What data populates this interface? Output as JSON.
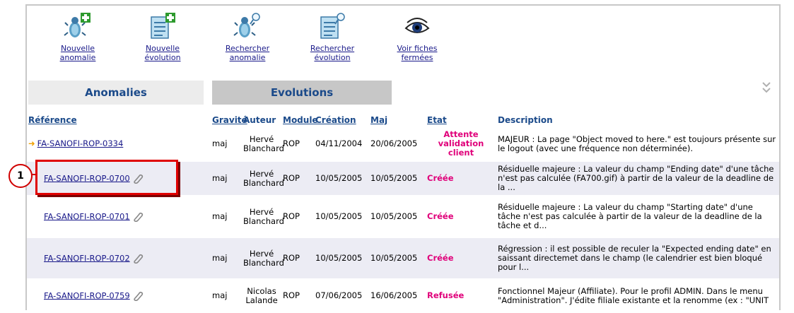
{
  "toolbar": {
    "new_anomaly": [
      "Nouvelle",
      "anomalie"
    ],
    "new_evolution": [
      "Nouvelle",
      "évolution"
    ],
    "search_anomaly": [
      "Rechercher",
      "anomalie"
    ],
    "search_evolution": [
      "Rechercher",
      "évolution"
    ],
    "closed_files": [
      "Voir fiches",
      "fermées"
    ]
  },
  "tabs": {
    "anomalies": "Anomalies",
    "evolutions": "Evolutions"
  },
  "columns": {
    "reference": "Référence",
    "gravite": "Gravité",
    "auteur": "Auteur",
    "module": "Module",
    "creation": "Création",
    "maj": "Maj",
    "etat": "Etat",
    "description": "Description"
  },
  "rows": [
    {
      "reference": "FA-SANOFI-ROP-0334",
      "gravite": "maj",
      "auteur": [
        "Hervé",
        "Blanchard"
      ],
      "module": "ROP",
      "creation": "04/11/2004",
      "maj": "20/06/2005",
      "etat": [
        "Attente",
        "validation",
        "client"
      ],
      "description": "MAJEUR : La page \"Object moved to here.\" est toujours présente sur le logout (avec une fréquence non déterminée)."
    },
    {
      "reference": "FA-SANOFI-ROP-0700",
      "gravite": "maj",
      "auteur": [
        "Hervé",
        "Blanchard"
      ],
      "module": "ROP",
      "creation": "10/05/2005",
      "maj": "10/05/2005",
      "etat": [
        "Créée"
      ],
      "description": "Résiduelle majeure : La valeur du champ \"Ending date\" d'une tâche n'est pas calculée (FA700.gif) à partir de la valeur de la deadline de la ..."
    },
    {
      "reference": "FA-SANOFI-ROP-0701",
      "gravite": "maj",
      "auteur": [
        "Hervé",
        "Blanchard"
      ],
      "module": "ROP",
      "creation": "10/05/2005",
      "maj": "10/05/2005",
      "etat": [
        "Créée"
      ],
      "description": "Résiduelle majeure : La valeur du champ \"Starting date\" d'une tâche n'est pas calculée à partir de la valeur de la deadline de la tâche et d..."
    },
    {
      "reference": "FA-SANOFI-ROP-0702",
      "gravite": "maj",
      "auteur": [
        "Hervé",
        "Blanchard"
      ],
      "module": "ROP",
      "creation": "10/05/2005",
      "maj": "10/05/2005",
      "etat": [
        "Créée"
      ],
      "description": "Régression : il est possible de reculer la \"Expected ending date\" en saissant directemet dans le champ (le calendrier est bien bloqué pour l..."
    },
    {
      "reference": "FA-SANOFI-ROP-0759",
      "gravite": "maj",
      "auteur": [
        "Nicolas",
        "Lalande"
      ],
      "module": "ROP",
      "creation": "07/06/2005",
      "maj": "16/06/2005",
      "etat": [
        "Refusée"
      ],
      "description": "Fonctionnel Majeur (Affiliate). Pour le profil ADMIN. Dans le menu \"Administration\". J'édite filiale existante et la renomme (ex : \"UNIT"
    }
  ],
  "callout": {
    "number": "1"
  },
  "colors": {
    "link": "#1a1a8a",
    "header": "#1b4a8a",
    "status": "#e0007a",
    "callout": "#e00000",
    "row_alt": "#ececf4"
  }
}
